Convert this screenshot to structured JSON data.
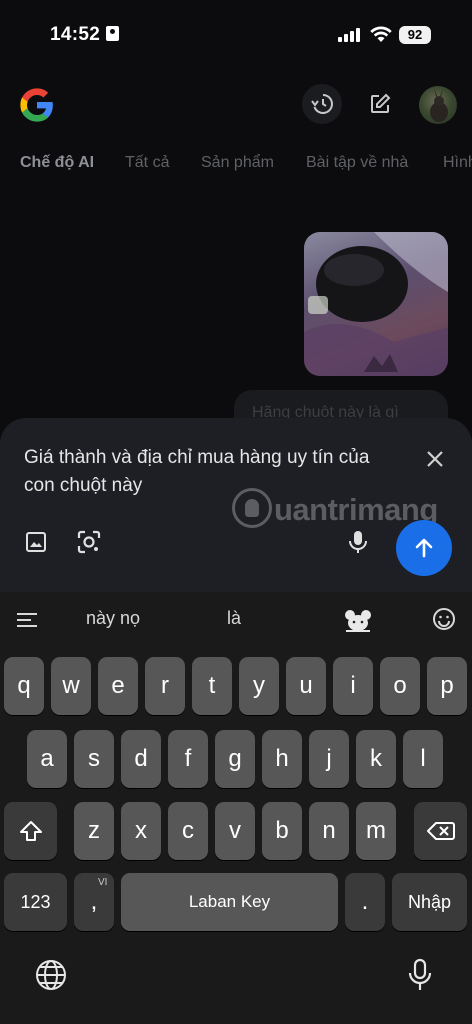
{
  "status": {
    "time": "14:52",
    "battery": "92"
  },
  "tabs": [
    "Chế độ AI",
    "Tất cả",
    "Sản phẩm",
    "Bài tập về nhà",
    "Hình"
  ],
  "chat": {
    "previous_question": "Hãng chuột này là gì"
  },
  "composer": {
    "text": "Giá thành và địa chỉ mua hàng uy tín của con chuột này"
  },
  "watermark": "uantrimang",
  "keyboard": {
    "suggestions": [
      "này nọ",
      "là"
    ],
    "row1": [
      "q",
      "w",
      "e",
      "r",
      "t",
      "y",
      "u",
      "i",
      "o",
      "p"
    ],
    "row2": [
      "a",
      "s",
      "d",
      "f",
      "g",
      "h",
      "j",
      "k",
      "l"
    ],
    "row3": [
      "z",
      "x",
      "c",
      "v",
      "b",
      "n",
      "m"
    ],
    "numbers_key": "123",
    "comma_key": ",",
    "comma_sub": "VI",
    "space_label": "Laban Key",
    "period_key": ".",
    "enter_label": "Nhập"
  },
  "icons": {
    "google_logo": "google-logo",
    "history": "history-icon",
    "new_chat": "edit-icon",
    "close": "close-icon",
    "image": "image-icon",
    "lens": "lens-icon",
    "mic": "mic-icon",
    "send": "send-icon"
  },
  "colors": {
    "send_button": "#1a6fe8",
    "background": "#0c0c0e",
    "composer": "#1e1f25"
  }
}
